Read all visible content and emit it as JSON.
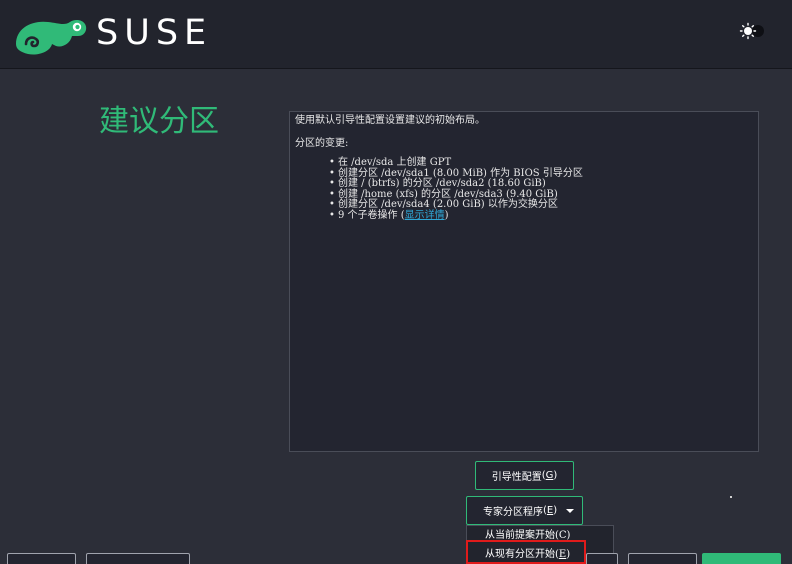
{
  "header": {
    "brand": "SUSE",
    "logo_icon": "chameleon-icon",
    "theme_icon": "sun-icon"
  },
  "page_title": "建议分区",
  "summary": {
    "intro": "使用默认引导性配置设置建议的初始布局。",
    "changes_label": "分区的变更:",
    "items": [
      "在 /dev/sda 上创建 GPT",
      "创建分区 /dev/sda1 (8.00 MiB) 作为 BIOS 引导分区",
      "创建 / (btrfs) 的分区 /dev/sda2 (18.60 GiB)",
      "创建 /home (xfs) 的分区 /dev/sda3 (9.40 GiB)",
      "创建分区 /dev/sda4 (2.00 GiB) 以作为交换分区"
    ],
    "last_item_prefix": "9 个子卷操作 (",
    "details_link": "显示详情",
    "last_item_suffix": ")"
  },
  "buttons": {
    "guided_setup": "引导性配置",
    "guided_setup_key": "G",
    "expert_partitioner": "专家分区程序",
    "expert_partitioner_key": "E"
  },
  "dropdown": {
    "item_current_proposal": "从当前提案开始(C)",
    "item_existing_partitions_prefix": "从现有分区开始(",
    "item_existing_partitions_key": "E",
    "item_existing_partitions_suffix": ")"
  },
  "colors": {
    "accent": "#30ba78",
    "link": "#2fa7d6",
    "highlight": "#e01b1b",
    "background": "#2c2e38",
    "header": "#22242d"
  }
}
